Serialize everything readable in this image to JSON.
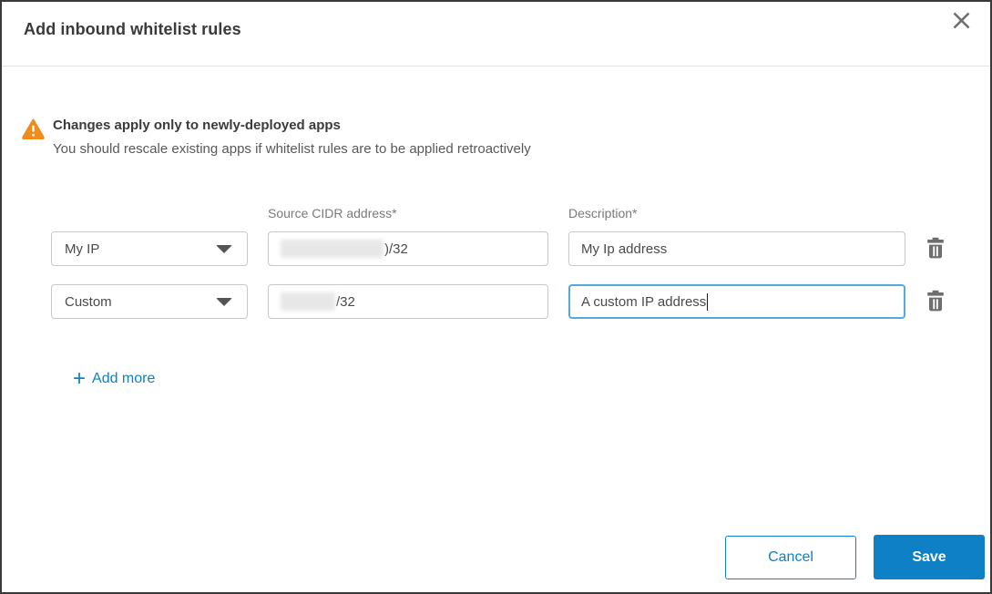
{
  "dialog": {
    "title": "Add inbound whitelist rules"
  },
  "warning": {
    "title": "Changes apply only to newly-deployed apps",
    "subtitle": "You should rescale existing apps if whitelist rules are to be applied retroactively"
  },
  "form": {
    "columns": {
      "source_cidr_label": "Source CIDR address*",
      "description_label": "Description*"
    },
    "rows": [
      {
        "type_selected": "My IP",
        "cidr_redacted": true,
        "cidr_visible_suffix": ")/32",
        "description": "My Ip address",
        "description_focused": false
      },
      {
        "type_selected": "Custom",
        "cidr_redacted": true,
        "cidr_visible_suffix": "/32",
        "description": "A custom IP address",
        "description_focused": true
      }
    ],
    "add_more_icon": "+",
    "add_more_label": "Add more"
  },
  "footer": {
    "cancel_label": "Cancel",
    "save_label": "Save"
  },
  "colors": {
    "accent_blue": "#0d80c6",
    "focus_border": "#55a7dd",
    "warning_orange": "#f08b1d"
  }
}
